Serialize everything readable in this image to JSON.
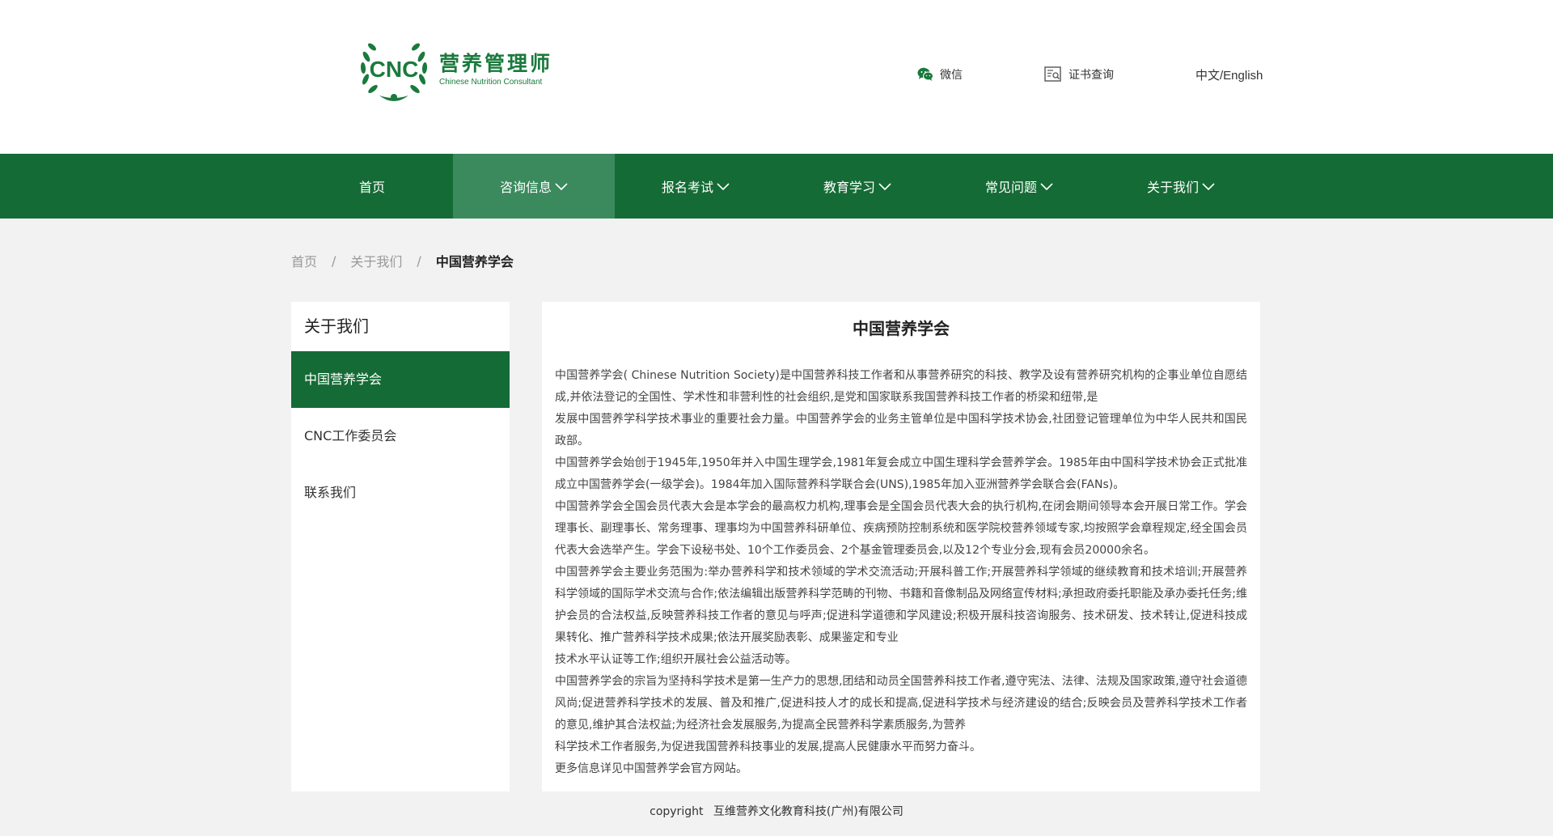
{
  "header": {
    "logo": {
      "mark_text": "CNC",
      "title_cn": "营养管理师",
      "title_en": "Chinese Nutrition Consultant"
    },
    "links": {
      "wechat": "微信",
      "cert": "证书查询",
      "lang": "中文/English"
    }
  },
  "nav": {
    "items": [
      {
        "label": "首页"
      },
      {
        "label": "咨询信息"
      },
      {
        "label": "报名考试"
      },
      {
        "label": "教育学习"
      },
      {
        "label": "常见问题"
      },
      {
        "label": "关于我们"
      }
    ],
    "active_index": 1
  },
  "breadcrumb": {
    "items": [
      "首页",
      "关于我们",
      "中国营养学会"
    ],
    "separator": "/"
  },
  "sidebar": {
    "title": "关于我们",
    "items": [
      {
        "label": "中国营养学会"
      },
      {
        "label": "CNC工作委员会"
      },
      {
        "label": "联系我们"
      }
    ]
  },
  "article": {
    "title": "中国营养学会",
    "paragraphs": [
      "中国营养学会( Chinese Nutrition Society)是中国营养科技工作者和从事营养研究的科技、教学及设有营养研究机构的企事业单位自愿结成,并依法登记的全国性、学术性和非营利性的社会组织,是党和国家联系我国营养科技工作者的桥梁和纽带,是",
      "发展中国营养学科学技术事业的重要社会力量。中国营养学会的业务主管单位是中国科学技术协会,社团登记管理单位为中华人民共和国民政部。",
      "中国营养学会始创于1945年,1950年并入中国生理学会,1981年复会成立中国生理科学会营养学会。1985年由中国科学技术协会正式批准成立中国营养学会(一级学会)。1984年加入国际营养科学联合会(UNS),1985年加入亚洲营养学会联合会(FANs)。",
      "中国营养学会全国会员代表大会是本学会的最高权力机构,理事会是全国会员代表大会的执行机构,在闭会期间领导本会开展日常工作。学会理事长、副理事长、常务理事、理事均为中国营养科研单位、疾病预防控制系统和医学院校营养领域专家,均按照学会章程规定,经全国会员代表大会选举产生。学会下设秘书处、10个工作委员会、2个基金管理委员会,以及12个专业分会,现有会员20000余名。",
      "中国营养学会主要业务范围为:举办营养科学和技术领域的学术交流活动;开展科普工作;开展营养科学领域的继续教育和技术培训;开展营养科学领域的国际学术交流与合作;依法编辑出版营养科学范畴的刊物、书籍和音像制品及网络宣传材料;承担政府委托职能及承办委托任务;维护会员的合法权益,反映营养科技工作者的意见与呼声;促进科学道德和学风建设;积极开展科技咨询服务、技术研发、技术转让,促进科技成果转化、推广营养科学技术成果;依法开展奖励表彰、成果鉴定和专业",
      "技术水平认证等工作;组织开展社会公益活动等。",
      "中国营养学会的宗旨为坚持科学技术是第一生产力的思想,团结和动员全国营养科技工作者,遵守宪法、法律、法规及国家政策,遵守社会道德风尚;促进营养科学技术的发展、普及和推广,促进科技人才的成长和提高,促进科学技术与经济建设的结合;反映会员及营养科学技术工作者的意见,维护其合法权益;为经济社会发展服务,为提高全民营养科学素质服务,为营养",
      "科学技术工作者服务,为促进我国营养科技事业的发展,提高人民健康水平而努力奋斗。",
      "更多信息详见中国营养学会官方网站。"
    ]
  },
  "footer": {
    "copyright_label": "copyright",
    "company": "互维营养文化教育科技(广州)有限公司"
  },
  "colors": {
    "brand_green": "#156b35",
    "nav_active": "#3a8a5e",
    "logo_green": "#1a7a3c",
    "page_bg": "#f2f2f2"
  },
  "icons": {
    "wechat": "wechat-icon",
    "cert": "certificate-search-icon",
    "nav_dropdown": "chevron-down-icon"
  }
}
